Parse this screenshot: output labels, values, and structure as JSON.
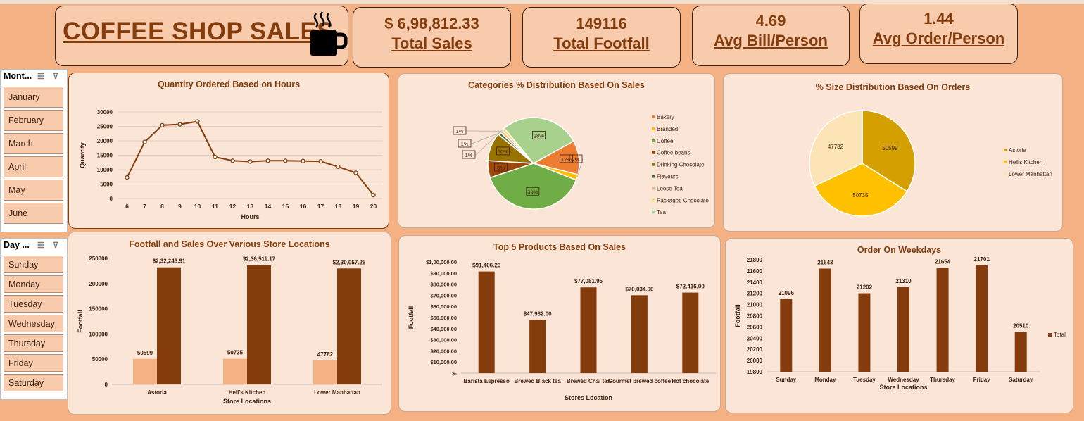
{
  "header": {
    "title": "COFFEE SHOP SALES"
  },
  "kpis": [
    {
      "value": "$ 6,98,812.33",
      "label": "Total Sales"
    },
    {
      "value": "149116",
      "label": "Total Footfall"
    },
    {
      "value": "4.69",
      "label": "Avg Bill/Person"
    },
    {
      "value": "1.44",
      "label": "Avg Order/Person"
    }
  ],
  "slicers": {
    "month": {
      "title": "Mont...",
      "items": [
        "January",
        "February",
        "March",
        "April",
        "May",
        "June"
      ]
    },
    "day": {
      "title": "Day ...",
      "items": [
        "Sunday",
        "Monday",
        "Tuesday",
        "Wednesday",
        "Thursday",
        "Friday",
        "Saturday"
      ]
    }
  },
  "colors": {
    "dark_brown": "#843c0c",
    "light_orange": "#f4b183",
    "card_bg": "#fbe5d6"
  },
  "chart_data": [
    {
      "id": "hours",
      "type": "line",
      "title": "Quantity Ordered Based on Hours",
      "xlabel": "Hours",
      "ylabel": "Quantity",
      "x": [
        6,
        7,
        8,
        9,
        10,
        11,
        12,
        13,
        14,
        15,
        16,
        17,
        18,
        19,
        20
      ],
      "values": [
        7300,
        19600,
        25400,
        25700,
        26700,
        14400,
        13100,
        12800,
        13100,
        13100,
        13000,
        12900,
        11000,
        8900,
        1200
      ],
      "yticks": [
        "0",
        "5000",
        "10000",
        "15000",
        "20000",
        "25000",
        "30000"
      ],
      "ylim": [
        0,
        30000
      ]
    },
    {
      "id": "categories",
      "type": "pie",
      "title": "Categories % Distribution Based On Sales",
      "categories": [
        "Bakery",
        "Branded",
        "Coffee",
        "Coffee beans",
        "Drinking Chocolate",
        "Flavours",
        "Loose Tea",
        "Packaged Chocolate",
        "Tea"
      ],
      "values": [
        12,
        2,
        39,
        6,
        10,
        1,
        1,
        1,
        28
      ],
      "labels": [
        "12%",
        "2%",
        "39%",
        "6%",
        "10%",
        "1%",
        "1%",
        "1%",
        "28%"
      ],
      "colors": [
        "#ed7d31",
        "#ffc000",
        "#70ad47",
        "#9e480e",
        "#997300",
        "#43682b",
        "#f4b183",
        "#ffd966",
        "#a9d18e"
      ]
    },
    {
      "id": "sizes",
      "type": "pie",
      "title": "% Size Distribution Based On Orders",
      "categories": [
        "Astoria",
        "Hell's Kitchen",
        "Lower Manhattan"
      ],
      "values": [
        50599,
        50735,
        47782
      ],
      "labels": [
        "50599",
        "50735",
        "47782"
      ],
      "colors": [
        "#d4a000",
        "#ffc000",
        "#fce4b6"
      ]
    },
    {
      "id": "locations",
      "type": "bar",
      "title": "Footfall and Sales Over Various Store Locations",
      "xlabel": "Store Locations",
      "ylabel": "Footfall",
      "categories": [
        "Astoria",
        "Hell's Kitchen",
        "Lower Manhattan"
      ],
      "series": [
        {
          "values": [
            50599,
            50735,
            47782
          ],
          "labels": [
            "50599",
            "50735",
            "47782"
          ],
          "color": "#f4b183"
        },
        {
          "values": [
            232243.91,
            236511.17,
            230057.25
          ],
          "labels": [
            "$2,32,243.91",
            "$2,36,511.17",
            "$2,30,057.25"
          ],
          "color": "#843c0c"
        }
      ],
      "yticks": [
        "0",
        "50000",
        "100000",
        "150000",
        "200000",
        "250000"
      ],
      "ylim": [
        0,
        250000
      ]
    },
    {
      "id": "products",
      "type": "bar",
      "title": "Top 5 Products Based On Sales",
      "xlabel": "Stores Location",
      "ylabel": "Footfall",
      "categories": [
        "Barista Espresso",
        "Brewed Black tea",
        "Brewed Chai tea",
        "Gourmet brewed coffee",
        "Hot chocolate"
      ],
      "values": [
        91406.2,
        47932.0,
        77081.95,
        70034.6,
        72416.0
      ],
      "labels": [
        "$91,406.20",
        "$47,932.00",
        "$77,081.95",
        "$70,034.60",
        "$72,416.00"
      ],
      "yticks": [
        "$-",
        "$10,000.00",
        "$20,000.00",
        "$30,000.00",
        "$40,000.00",
        "$50,000.00",
        "$60,000.00",
        "$70,000.00",
        "$80,000.00",
        "$90,000.00",
        "$1,00,000.00"
      ],
      "ylim": [
        0,
        100000
      ]
    },
    {
      "id": "weekdays",
      "type": "bar",
      "title": "Order On Weekdays",
      "xlabel": "Store Locations",
      "ylabel": "Footfall",
      "legend": "Total",
      "categories": [
        "Sunday",
        "Monday",
        "Tuesday",
        "Wednesday",
        "Thursday",
        "Friday",
        "Saturday"
      ],
      "values": [
        21096,
        21643,
        21202,
        21310,
        21654,
        21701,
        20510
      ],
      "labels": [
        "21096",
        "21643",
        "21202",
        "21310",
        "21654",
        "21701",
        "20510"
      ],
      "yticks": [
        "19800",
        "20000",
        "20200",
        "20400",
        "20600",
        "20800",
        "21000",
        "21200",
        "21400",
        "21600",
        "21800"
      ],
      "ylim": [
        19800,
        21800
      ]
    }
  ]
}
